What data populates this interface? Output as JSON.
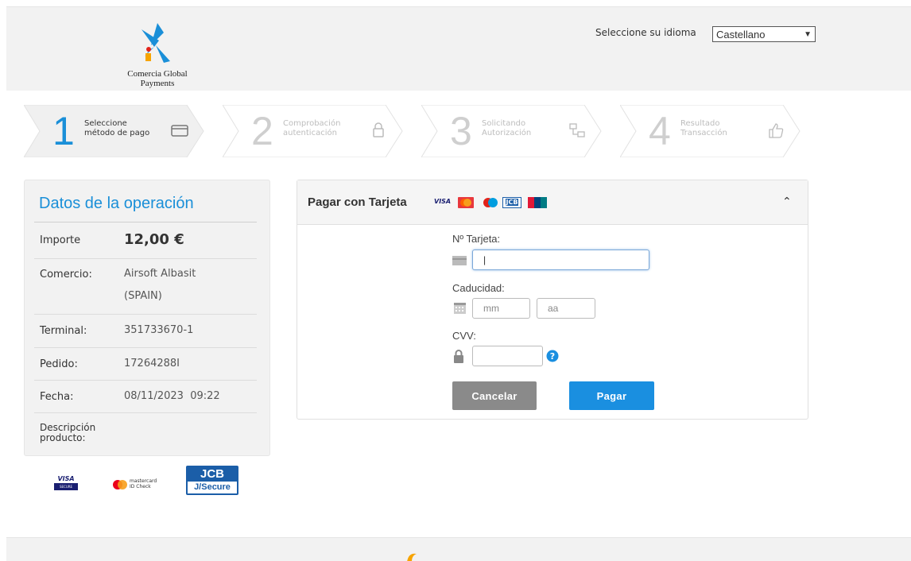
{
  "header": {
    "brand_name": "Comercia Global Payments",
    "language_label": "Seleccione su idioma",
    "language_selected": "Castellano"
  },
  "steps": [
    {
      "number": "1",
      "line1": "Seleccione",
      "line2": "método de pago",
      "icon": "credit-card-icon",
      "state": "active"
    },
    {
      "number": "2",
      "line1": "Comprobación",
      "line2": "autenticación",
      "icon": "lock-icon",
      "state": "inactive"
    },
    {
      "number": "3",
      "line1": "Solicitando",
      "line2": "Autorización",
      "icon": "network-icon",
      "state": "inactive"
    },
    {
      "number": "4",
      "line1": "Resultado",
      "line2": "Transacción",
      "icon": "thumbs-up-icon",
      "state": "inactive"
    }
  ],
  "operation": {
    "title": "Datos de la operación",
    "rows": [
      {
        "key": "Importe",
        "value": "12,00 €"
      },
      {
        "key": "Comercio:",
        "value_line1": "Airsoft Albasit",
        "value_line2": "(SPAIN)"
      },
      {
        "key": "Terminal:",
        "value": "351733670-1"
      },
      {
        "key": "Pedido:",
        "value": "17264288I"
      },
      {
        "key": "Fecha:",
        "value": "08/11/2023  09:22"
      },
      {
        "key_line1": "Descripción",
        "key_line2": "producto:",
        "value": ""
      }
    ]
  },
  "secure_logos": {
    "visa_line1": "VISA",
    "visa_line2": "SECURE",
    "mc_line1": "mastercard",
    "mc_line2": "ID Check",
    "jcb_line1": "JCB",
    "jcb_line2": "J/Secure"
  },
  "card_form": {
    "title": "Pagar con Tarjeta",
    "brand_visa": "VISA",
    "brand_jcb": "JCB",
    "card_number_label": "Nº Tarjeta:",
    "card_number_value": "|",
    "expiry_label": "Caducidad:",
    "month_placeholder": "mm",
    "year_placeholder": "aa",
    "cvv_label": "CVV:",
    "cancel_label": "Cancelar",
    "pay_label": "Pagar"
  },
  "colors": {
    "accent": "#1a8fd8",
    "pay_button": "#1a8fe0",
    "cancel_button": "#8a8a8a",
    "panel_bg": "#f2f2f2"
  }
}
